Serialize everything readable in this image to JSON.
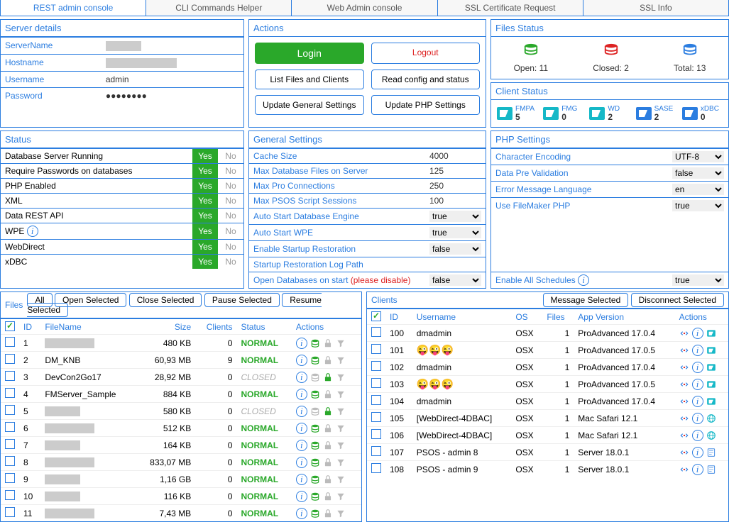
{
  "tabs": [
    "REST admin console",
    "CLI Commands Helper",
    "Web Admin console",
    "SSL Certificate Request",
    "SSL Info"
  ],
  "serverDetails": {
    "title": "Server details",
    "rows": [
      {
        "label": "ServerName",
        "value": "",
        "redact": "sm"
      },
      {
        "label": "Hostname",
        "value": "",
        "redact": "lg"
      },
      {
        "label": "Username",
        "value": "admin"
      },
      {
        "label": "Password",
        "value": "●●●●●●●●"
      }
    ]
  },
  "actions": {
    "title": "Actions",
    "login": "Login",
    "logout": "Logout",
    "listFiles": "List Files and Clients",
    "readConfig": "Read config and status",
    "updateGeneral": "Update General Settings",
    "updatePhp": "Update PHP Settings"
  },
  "filesStatus": {
    "title": "Files Status",
    "open": {
      "label": "Open:",
      "val": "11"
    },
    "closed": {
      "label": "Closed:",
      "val": "2"
    },
    "total": {
      "label": "Total:",
      "val": "13"
    }
  },
  "clientStatus": {
    "title": "Client Status",
    "items": [
      {
        "name": "FMPA",
        "val": "5"
      },
      {
        "name": "FMG",
        "val": "0"
      },
      {
        "name": "WD",
        "val": "2"
      },
      {
        "name": "SASE",
        "val": "2"
      },
      {
        "name": "xDBC",
        "val": "0"
      }
    ]
  },
  "status": {
    "title": "Status",
    "rows": [
      {
        "label": "Database Server Running",
        "yes": true
      },
      {
        "label": "Require Passwords on databases",
        "yes": true
      },
      {
        "label": "PHP Enabled",
        "yes": true
      },
      {
        "label": "XML",
        "yes": true,
        "info": false
      },
      {
        "label": "Data REST API",
        "yes": true
      },
      {
        "label": "WPE",
        "yes": true,
        "info": true
      },
      {
        "label": "WebDirect",
        "yes": true
      },
      {
        "label": "xDBC",
        "yes": true
      }
    ]
  },
  "general": {
    "title": "General Settings",
    "rows": [
      {
        "label": "Cache Size",
        "val": "4000",
        "type": "text"
      },
      {
        "label": "Max Database Files on Server",
        "val": "125",
        "type": "text"
      },
      {
        "label": "Max Pro Connections",
        "val": "250",
        "type": "text"
      },
      {
        "label": "Max PSOS Script Sessions",
        "val": "100",
        "type": "text"
      },
      {
        "label": "Auto Start Database Engine",
        "val": "true",
        "type": "select"
      },
      {
        "label": "Auto Start WPE",
        "val": "true",
        "type": "select"
      },
      {
        "label": "Enable Startup Restoration",
        "val": "false",
        "type": "select"
      },
      {
        "label": "Startup Restoration Log Path",
        "val": "",
        "type": "text"
      },
      {
        "label": "Open Databases on start",
        "extra": "(please disable)",
        "val": "false",
        "type": "select"
      }
    ]
  },
  "php": {
    "title": "PHP Settings",
    "rows": [
      {
        "label": "Character Encoding",
        "val": "UTF-8"
      },
      {
        "label": "Data Pre Validation",
        "val": "false"
      },
      {
        "label": "Error Message Language",
        "val": "en"
      },
      {
        "label": "Use FileMaker PHP",
        "val": "true"
      }
    ],
    "schedules": {
      "label": "Enable All Schedules",
      "val": "true"
    }
  },
  "files": {
    "title": "Files",
    "buttons": [
      "All",
      "Open Selected",
      "Close Selected",
      "Pause Selected",
      "Resume Selected"
    ],
    "headers": [
      "ID",
      "FileName",
      "Size",
      "Clients",
      "Status",
      "Actions"
    ],
    "rows": [
      {
        "id": "1",
        "name": "",
        "redact": "md",
        "size": "480 KB",
        "clients": "0",
        "status": "NORMAL"
      },
      {
        "id": "2",
        "name": "DM_KNB",
        "size": "60,93 MB",
        "clients": "9",
        "status": "NORMAL"
      },
      {
        "id": "3",
        "name": "DevCon2Go17",
        "size": "28,92 MB",
        "clients": "0",
        "status": "CLOSED"
      },
      {
        "id": "4",
        "name": "FMServer_Sample",
        "size": "884 KB",
        "clients": "0",
        "status": "NORMAL"
      },
      {
        "id": "5",
        "name": "",
        "redact": "sm",
        "size": "580 KB",
        "clients": "0",
        "status": "CLOSED"
      },
      {
        "id": "6",
        "name": "",
        "redact": "md",
        "size": "512 KB",
        "clients": "0",
        "status": "NORMAL"
      },
      {
        "id": "7",
        "name": "",
        "redact": "sm",
        "size": "164 KB",
        "clients": "0",
        "status": "NORMAL"
      },
      {
        "id": "8",
        "name": "",
        "redact": "md",
        "size": "833,07 MB",
        "clients": "0",
        "status": "NORMAL"
      },
      {
        "id": "9",
        "name": "",
        "redact": "sm",
        "size": "1,16 GB",
        "clients": "0",
        "status": "NORMAL"
      },
      {
        "id": "10",
        "name": "",
        "redact": "sm",
        "size": "116 KB",
        "clients": "0",
        "status": "NORMAL"
      },
      {
        "id": "11",
        "name": "",
        "redact": "md",
        "size": "7,43 MB",
        "clients": "0",
        "status": "NORMAL"
      }
    ]
  },
  "clients": {
    "title": "Clients",
    "buttons": [
      "Message Selected",
      "Disconnect Selected"
    ],
    "headers": [
      "ID",
      "Username",
      "OS",
      "Files",
      "App Version",
      "Actions"
    ],
    "rows": [
      {
        "id": "100",
        "user": "dmadmin",
        "os": "OSX",
        "files": "1",
        "ver": "ProAdvanced 17.0.4",
        "type": "fm"
      },
      {
        "id": "101",
        "user": "😜😜😜",
        "emoji": true,
        "os": "OSX",
        "files": "1",
        "ver": "ProAdvanced 17.0.5",
        "type": "fm"
      },
      {
        "id": "102",
        "user": "dmadmin",
        "os": "OSX",
        "files": "1",
        "ver": "ProAdvanced 17.0.4",
        "type": "fm"
      },
      {
        "id": "103",
        "user": "😜😜😜",
        "emoji": true,
        "os": "OSX",
        "files": "1",
        "ver": "ProAdvanced 17.0.5",
        "type": "fm"
      },
      {
        "id": "104",
        "user": "dmadmin",
        "os": "OSX",
        "files": "1",
        "ver": "ProAdvanced 17.0.4",
        "type": "fm"
      },
      {
        "id": "105",
        "user": "[WebDirect-4DBAC]",
        "os": "OSX",
        "files": "1",
        "ver": "Mac Safari 12.1",
        "type": "wd"
      },
      {
        "id": "106",
        "user": "[WebDirect-4DBAC]",
        "os": "OSX",
        "files": "1",
        "ver": "Mac Safari 12.1",
        "type": "wd"
      },
      {
        "id": "107",
        "user": "PSOS - admin 8",
        "os": "OSX",
        "files": "1",
        "ver": "Server 18.0.1",
        "type": "psos"
      },
      {
        "id": "108",
        "user": "PSOS - admin 9",
        "os": "OSX",
        "files": "1",
        "ver": "Server 18.0.1",
        "type": "psos"
      }
    ]
  }
}
